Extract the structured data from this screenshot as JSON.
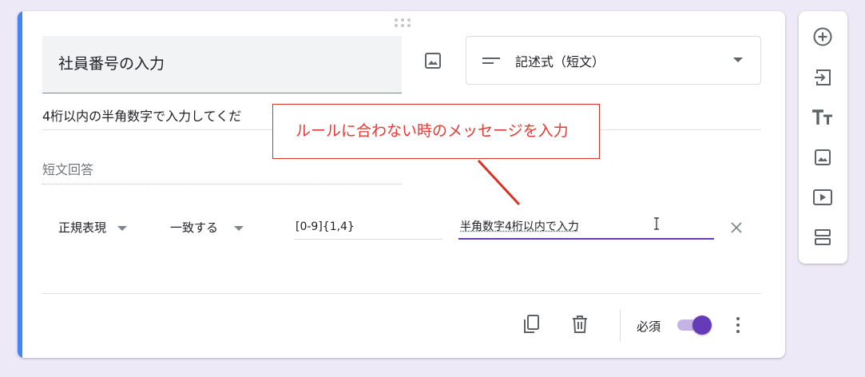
{
  "question": {
    "title": "社員番号の入力",
    "type_label": "記述式（短文）",
    "description": "4桁以内の半角数字で入力してくだ",
    "answer_hint": "短文回答"
  },
  "validation": {
    "category": "正規表現",
    "condition": "一致する",
    "pattern": "[0-9]{1,4}",
    "error_message": "半角数字4桁以内で入力"
  },
  "footer": {
    "required_label": "必須",
    "required_on": true
  },
  "annotation": {
    "text": "ルールに合わない時のメッセージを入力"
  },
  "colors": {
    "accent": "#673ab7",
    "card_border": "#4285f4",
    "annotation": "#d93025",
    "background": "#ede9f7"
  },
  "icons": {
    "side_toolbar": [
      "add-question-icon",
      "import-questions-icon",
      "add-title-icon",
      "add-image-icon",
      "add-video-icon",
      "add-section-icon"
    ],
    "footer": [
      "duplicate-icon",
      "delete-icon",
      "more-vert-icon"
    ]
  }
}
